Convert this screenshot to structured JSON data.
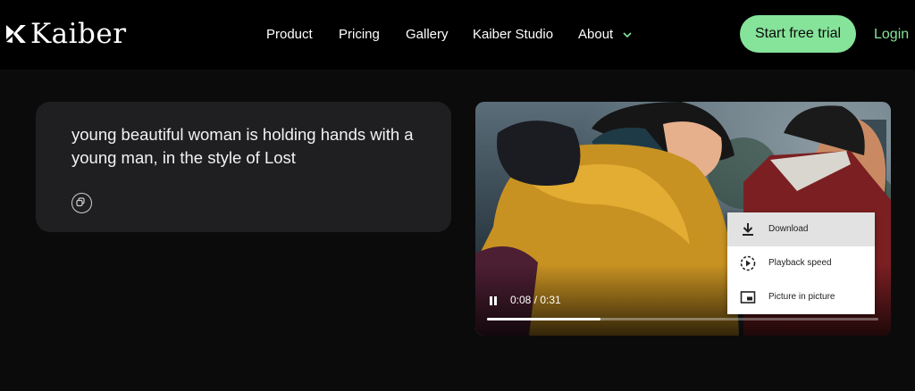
{
  "brand": {
    "name": "Kaiber"
  },
  "nav": {
    "items": [
      "Product",
      "Pricing",
      "Gallery",
      "Kaiber Studio",
      "About"
    ],
    "cta": "Start free trial",
    "login": "Login"
  },
  "prompt": {
    "text": "young beautiful woman is holding hands with a young man, in the style of Lost"
  },
  "video": {
    "time": "0:08 / 0:31",
    "progress": 0.29,
    "menu": [
      "Download",
      "Playback speed",
      "Picture in picture"
    ]
  },
  "colors": {
    "accent": "#86e39a",
    "background": "#0b0b0b",
    "card": "#1f1f22"
  },
  "icons": [
    "kaiber-logo-icon",
    "chevron-down-icon",
    "copy-icon",
    "pause-icon",
    "download-icon",
    "playback-speed-icon",
    "picture-in-picture-icon"
  ]
}
